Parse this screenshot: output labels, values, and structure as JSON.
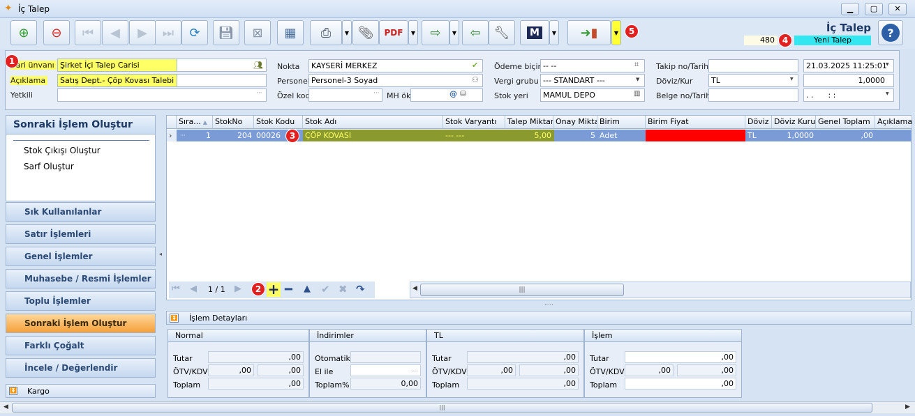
{
  "window": {
    "title": "İç Talep",
    "minimize": "▁",
    "maximize": "▢",
    "close": "✕"
  },
  "header": {
    "doc_title": "İç Talep",
    "doc_number": "480",
    "status": "Yeni Talep",
    "help": "?"
  },
  "form": {
    "cari_label": "Cari ünvanı",
    "cari_value": "Şirket İçi Talep Carisi",
    "aciklama_label": "Açıklama",
    "aciklama_value": "Satış Dept.- Çöp Kovası Talebi",
    "yetkili_label": "Yetkili",
    "yetkili_value": "",
    "nokta_label": "Nokta",
    "nokta_value": "KAYSERİ MERKEZ",
    "personel_label": "Personel",
    "personel_value": "Personel-3 Soyad",
    "ozelkod_label": "Özel kod",
    "ozelkod_value": "",
    "mhok_label": "MH ök",
    "mhok_value": "",
    "odeme_label": "Ödeme biçimi",
    "odeme_value": "-- --",
    "vergi_label": "Vergi grubu",
    "vergi_value": "--- STANDART ---",
    "stokyeri_label": "Stok yeri",
    "stokyeri_value": "MAMUL DEPO",
    "takip_label": "Takip no/Tarih",
    "takip_value": "",
    "takip_date": "21.03.2025 11:25:01",
    "doviz_label": "Döviz/Kur",
    "doviz_value": "TL",
    "kur_value": "1,0000",
    "belge_label": "Belge no/Tarih",
    "belge_value": "",
    "belge_date": ". .      : :"
  },
  "left_panel": {
    "title": "Sonraki İşlem Oluştur",
    "actions": [
      "Stok Çıkışı Oluştur",
      "Sarf Oluştur"
    ],
    "menu": [
      "Sık Kullanılanlar",
      "Satır İşlemleri",
      "Genel İşlemler",
      "Muhasebe / Resmi İşlemler",
      "Toplu İşlemler",
      "Sonraki İşlem Oluştur",
      "Farklı Çoğalt",
      "İncele / Değerlendir"
    ],
    "kargo": "Kargo"
  },
  "grid": {
    "columns": [
      "Sıra...",
      "StokNo",
      "Stok Kodu",
      "Stok Adı",
      "Stok Varyantı",
      "Talep Miktar",
      "Onay Miktar",
      "Birim",
      "Birim Fiyat",
      "Döviz",
      "Döviz Kuru",
      "Genel Toplam",
      "Açıklama"
    ],
    "row": {
      "sira": "1",
      "stokno": "204",
      "stokkodu": "00026",
      "stokadi": "ÇÖP KOVASI",
      "varyant": "--- ---",
      "talep": "5,00",
      "onay": "5",
      "birim": "Adet",
      "fiyat": "",
      "doviz": "TL",
      "kur": "1,0000",
      "toplam": ",00",
      "aciklama": ""
    },
    "pager": "1 / 1",
    "scroll_grip": "|||"
  },
  "details": {
    "toggle_label": "İşlem Detayları",
    "normal": {
      "title": "Normal",
      "tutar_label": "Tutar",
      "tutar": ",00",
      "otv_label": "ÖTV/KDV",
      "otv": ",00",
      "kdv": ",00",
      "toplam_label": "Toplam",
      "toplam": ",00"
    },
    "indirim": {
      "title": "İndirimler",
      "otomatik_label": "Otomatik",
      "otomatik": "",
      "elile_label": "El ile",
      "elile": "...",
      "toplam_label": "Toplam%",
      "toplam": "0,00"
    },
    "tl": {
      "title": "TL",
      "tutar_label": "Tutar",
      "tutar": ",00",
      "otv_label": "ÖTV/KDV",
      "otv": ",00",
      "kdv": ",00",
      "toplam_label": "Toplam",
      "toplam": ",00"
    },
    "islem": {
      "title": "İşlem",
      "tutar_label": "Tutar",
      "tutar": ",00",
      "otv_label": "ÖTV/KDV",
      "otv": ",00",
      "kdv": ",00",
      "toplam_label": "Toplam",
      "toplam": ",00"
    }
  },
  "badges": [
    "1",
    "2",
    "3",
    "4",
    "5"
  ],
  "colors": {
    "accent": "#1e3a64",
    "row_selected": "#7b9bd6",
    "row_highlight": "#8a9a2e",
    "price_cell": "#ff0000",
    "status_bg": "#33e6f0",
    "highlight": "#ffff66"
  }
}
